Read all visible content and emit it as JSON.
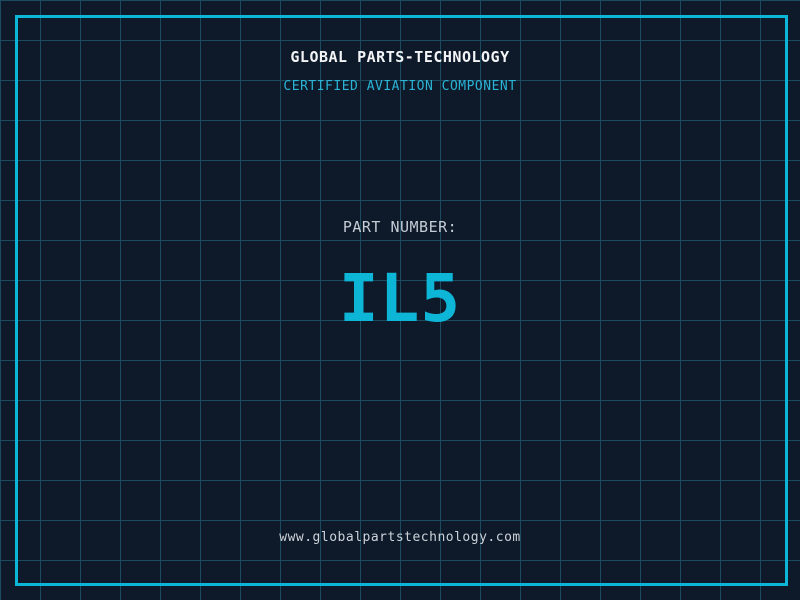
{
  "header": {
    "company": "GLOBAL PARTS-TECHNOLOGY",
    "subtitle": "CERTIFIED AVIATION COMPONENT"
  },
  "part": {
    "label": "PART NUMBER:",
    "number": "IL5"
  },
  "footer": {
    "website": "www.globalpartstechnology.com"
  },
  "colors": {
    "bg": "#0e1929",
    "grid": "#1c4a5e",
    "frame": "#0cb6d8",
    "cyan": "#2bb3d6",
    "part-cyan": "#0db5d7",
    "white": "#f2f4f6",
    "gray": "#c4ccd5",
    "lightgray": "#ccd3da"
  }
}
